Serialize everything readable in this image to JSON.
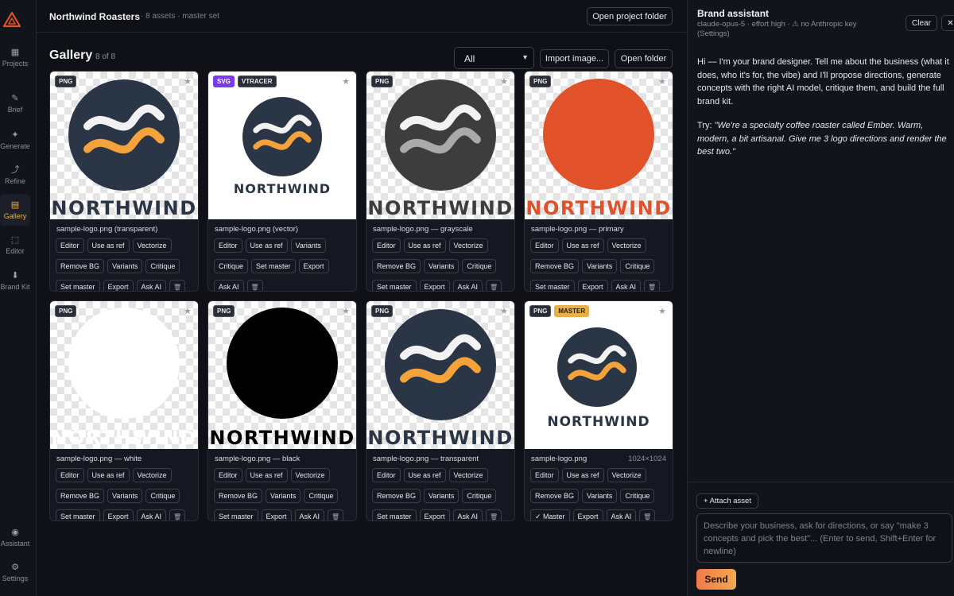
{
  "app": {
    "colors": {
      "accent": "#e6b34a",
      "send_gradient": [
        "#ef7a4c",
        "#f2a94e"
      ],
      "brand_navy": "#2a3545",
      "brand_orange": "#f4a23c",
      "brand_red": "#e1522b"
    }
  },
  "rail": {
    "items": [
      {
        "id": "projects",
        "label": "Projects",
        "icon": "grid-icon",
        "glyph": "▦"
      },
      {
        "id": "brief",
        "label": "Brief",
        "icon": "pencil-icon",
        "glyph": "✎"
      },
      {
        "id": "generate",
        "label": "Generate",
        "icon": "sparkle-icon",
        "glyph": "✦"
      },
      {
        "id": "refine",
        "label": "Refine",
        "icon": "arrow-icon",
        "glyph": "⤴"
      },
      {
        "id": "gallery",
        "label": "Gallery",
        "icon": "gallery-icon",
        "glyph": "▤",
        "active": true
      },
      {
        "id": "editor",
        "label": "Editor",
        "icon": "square-icon",
        "glyph": "⬚"
      },
      {
        "id": "brandkit",
        "label": "Brand Kit",
        "icon": "download-icon",
        "glyph": "⬇"
      },
      {
        "id": "assistant",
        "label": "Assistant",
        "icon": "circle-icon",
        "glyph": "◉"
      },
      {
        "id": "settings",
        "label": "Settings",
        "icon": "gear-icon",
        "glyph": "⚙"
      }
    ]
  },
  "header": {
    "project_title": "Northwind Roasters",
    "meta": "· 8 assets · master set",
    "open_folder_label": "Open project folder"
  },
  "gallery": {
    "title": "Gallery",
    "count": "8 of 8",
    "filter_value": "All",
    "import_label": "Import image...",
    "open_folder_label": "Open folder",
    "cards": [
      {
        "tags": [
          "PNG"
        ],
        "filename": "sample-logo.png (transparent)",
        "dims": "",
        "wordmark": "NORTHWIND",
        "actions": [
          "Editor",
          "Use as ref",
          "Vectorize",
          "|",
          "Remove BG",
          "Variants",
          "Critique",
          "|",
          "Set master",
          "Export",
          "Ask AI",
          "🗑"
        ]
      },
      {
        "tags": [
          "SVG",
          "VTRACER"
        ],
        "filename": "sample-logo.png (vector)",
        "dims": "",
        "wordmark": "NORTHWIND",
        "actions": [
          "Editor",
          "Use as ref",
          "Variants",
          "|",
          "Critique",
          "Set master",
          "Export",
          "|",
          "Ask AI",
          "🗑"
        ]
      },
      {
        "tags": [
          "PNG"
        ],
        "filename": "sample-logo.png — grayscale",
        "dims": "",
        "wordmark": "NORTHWIND",
        "actions": [
          "Editor",
          "Use as ref",
          "Vectorize",
          "|",
          "Remove BG",
          "Variants",
          "Critique",
          "|",
          "Set master",
          "Export",
          "Ask AI",
          "🗑"
        ]
      },
      {
        "tags": [
          "PNG"
        ],
        "filename": "sample-logo.png — primary",
        "dims": "",
        "wordmark": "NORTHWIND",
        "actions": [
          "Editor",
          "Use as ref",
          "Vectorize",
          "|",
          "Remove BG",
          "Variants",
          "Critique",
          "|",
          "Set master",
          "Export",
          "Ask AI",
          "🗑"
        ]
      },
      {
        "tags": [
          "PNG"
        ],
        "filename": "sample-logo.png — white",
        "dims": "",
        "wordmark": "NORTHWIND",
        "actions": [
          "Editor",
          "Use as ref",
          "Vectorize",
          "|",
          "Remove BG",
          "Variants",
          "Critique",
          "|",
          "Set master",
          "Export",
          "Ask AI",
          "🗑"
        ]
      },
      {
        "tags": [
          "PNG"
        ],
        "filename": "sample-logo.png — black",
        "dims": "",
        "wordmark": "NORTHWIND",
        "actions": [
          "Editor",
          "Use as ref",
          "Vectorize",
          "|",
          "Remove BG",
          "Variants",
          "Critique",
          "|",
          "Set master",
          "Export",
          "Ask AI",
          "🗑"
        ]
      },
      {
        "tags": [
          "PNG"
        ],
        "filename": "sample-logo.png — transparent",
        "dims": "",
        "wordmark": "NORTHWIND",
        "actions": [
          "Editor",
          "Use as ref",
          "Vectorize",
          "|",
          "Remove BG",
          "Variants",
          "Critique",
          "|",
          "Set master",
          "Export",
          "Ask AI",
          "🗑"
        ]
      },
      {
        "tags": [
          "PNG",
          "MASTER"
        ],
        "filename": "sample-logo.png",
        "dims": "1024×1024",
        "wordmark": "NORTHWIND",
        "actions": [
          "Editor",
          "Use as ref",
          "Vectorize",
          "|",
          "Remove BG",
          "Variants",
          "Critique",
          "|",
          "✓ Master",
          "Export",
          "Ask AI",
          "🗑"
        ]
      }
    ]
  },
  "assistant": {
    "title": "Brand assistant",
    "subtitle": "claude-opus-5 · effort high · ⚠ no Anthropic key (Settings)",
    "clear_label": "Clear",
    "close_glyph": "✕",
    "message": "Hi — I'm your brand designer. Tell me about the business (what it does, who it's for, the vibe) and I'll propose directions, generate concepts with the right AI model, critique them, and build the full brand kit.",
    "try_prefix": "Try:",
    "try_text": "\"We're a specialty coffee roaster called Ember. Warm, modern, a bit artisanal. Give me 3 logo directions and render the best two.\"",
    "attach_label": "+ Attach asset",
    "placeholder": "Describe your business, ask for directions, or say \"make 3 concepts and pick the best\"... (Enter to send, Shift+Enter for newline)",
    "send_label": "Send"
  }
}
